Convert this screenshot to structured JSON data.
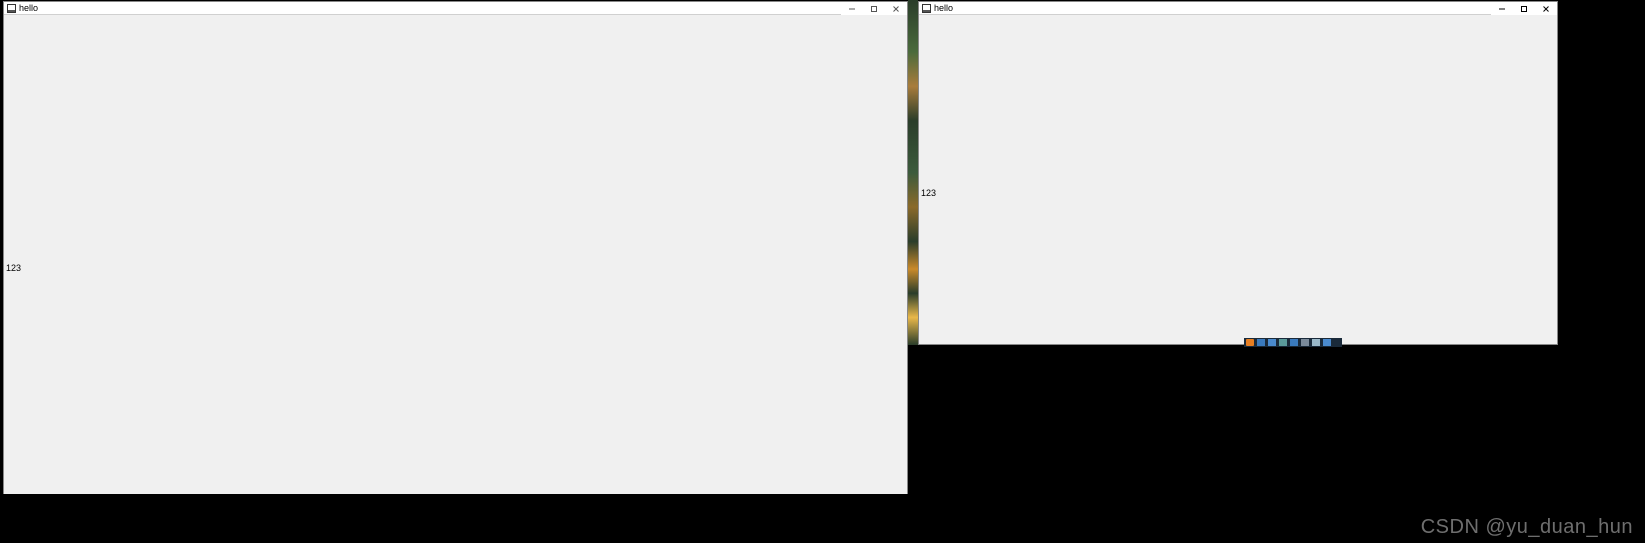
{
  "window_left": {
    "title": "hello",
    "content": "123"
  },
  "window_right": {
    "title": "hello",
    "content": "123"
  },
  "watermark": "CSDN @yu_duan_hun",
  "taskbar_icons": [
    "app1",
    "app2",
    "app3",
    "app4",
    "app5",
    "app6",
    "app7",
    "app8"
  ]
}
